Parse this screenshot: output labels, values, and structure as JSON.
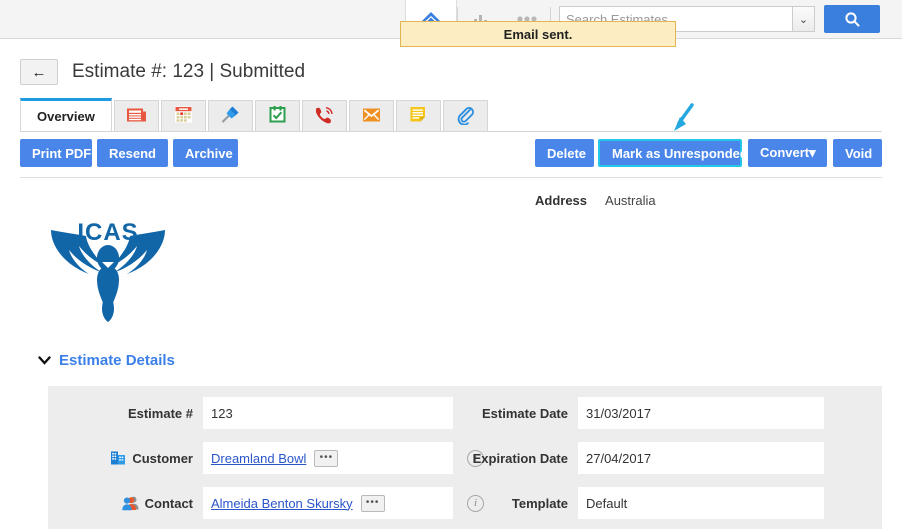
{
  "topbar": {
    "icons": [
      {
        "name": "home-icon",
        "label": "Home"
      },
      {
        "name": "bar-chart-icon",
        "label": "Reports"
      },
      {
        "name": "more-dots-icon",
        "label": "More"
      }
    ],
    "search": {
      "placeholder": "Search Estimates",
      "value": "",
      "dropdown_caret": "⌄",
      "go_icon": "search-icon"
    }
  },
  "toast": {
    "message": "Email sent.",
    "bg_color": "#fceec2",
    "border_color": "#e3b552"
  },
  "header": {
    "back_icon": "←",
    "title": "Estimate #: 123 | Submitted"
  },
  "tabs": [
    {
      "name": "tab-overview",
      "label": "Overview",
      "icon": null,
      "active": true
    },
    {
      "name": "tab-items",
      "label": "",
      "icon": "newspaper-icon",
      "active": false
    },
    {
      "name": "tab-calendar",
      "label": "",
      "icon": "calendar-icon",
      "active": false
    },
    {
      "name": "tab-pinned",
      "label": "",
      "icon": "pushpin-icon",
      "active": false
    },
    {
      "name": "tab-tasks",
      "label": "",
      "icon": "calendar-check-icon",
      "active": false
    },
    {
      "name": "tab-calls",
      "label": "",
      "icon": "phone-icon",
      "active": false
    },
    {
      "name": "tab-emails",
      "label": "",
      "icon": "envelope-icon",
      "active": false
    },
    {
      "name": "tab-notes",
      "label": "",
      "icon": "note-icon",
      "active": false
    },
    {
      "name": "tab-attachments",
      "label": "",
      "icon": "paperclip-icon",
      "active": false
    }
  ],
  "actions": {
    "left": [
      {
        "name": "print-pdf-button",
        "label": "Print PDF",
        "focused": false
      },
      {
        "name": "resend-button",
        "label": "Resend",
        "focused": false
      },
      {
        "name": "archive-button",
        "label": "Archive",
        "focused": false
      }
    ],
    "right": [
      {
        "name": "delete-button",
        "label": "Delete",
        "focused": false
      },
      {
        "name": "mark-as-unresponded-button",
        "label": "Mark as Unresponded",
        "focused": true
      },
      {
        "name": "convert-button",
        "label": "Convert▾",
        "focused": false
      },
      {
        "name": "void-button",
        "label": "Void",
        "focused": false
      }
    ],
    "accent_color": "#4a86ea",
    "focus_color": "#26c6e8"
  },
  "address": {
    "label": "Address",
    "value": "Australia"
  },
  "logo": {
    "alt": "ICAS",
    "text": "ICAS",
    "color": "#1166a8"
  },
  "section": {
    "caret": "⌄",
    "title": "Estimate Details",
    "title_color": "#3b7fe8"
  },
  "form": {
    "left": [
      {
        "name": "estimate-number-field",
        "label": "Estimate #",
        "value": "123",
        "icon": null,
        "link": false,
        "has_ellipsis": false,
        "has_info": false
      },
      {
        "name": "customer-field",
        "label": "Customer",
        "value": "Dreamland Bowl",
        "icon": "building-icon",
        "link": true,
        "has_ellipsis": true,
        "has_info": true,
        "ellipsis": "•••",
        "info": "i"
      },
      {
        "name": "contact-field",
        "label": "Contact",
        "value": "Almeida Benton Skursky",
        "icon": "people-icon",
        "link": true,
        "has_ellipsis": true,
        "has_info": true,
        "ellipsis": "•••",
        "info": "i"
      }
    ],
    "right": [
      {
        "name": "estimate-date-field",
        "label": "Estimate Date",
        "value": "31/03/2017"
      },
      {
        "name": "expiration-date-field",
        "label": "Expiration Date",
        "value": "27/04/2017"
      },
      {
        "name": "template-field",
        "label": "Template",
        "value": "Default"
      }
    ]
  }
}
